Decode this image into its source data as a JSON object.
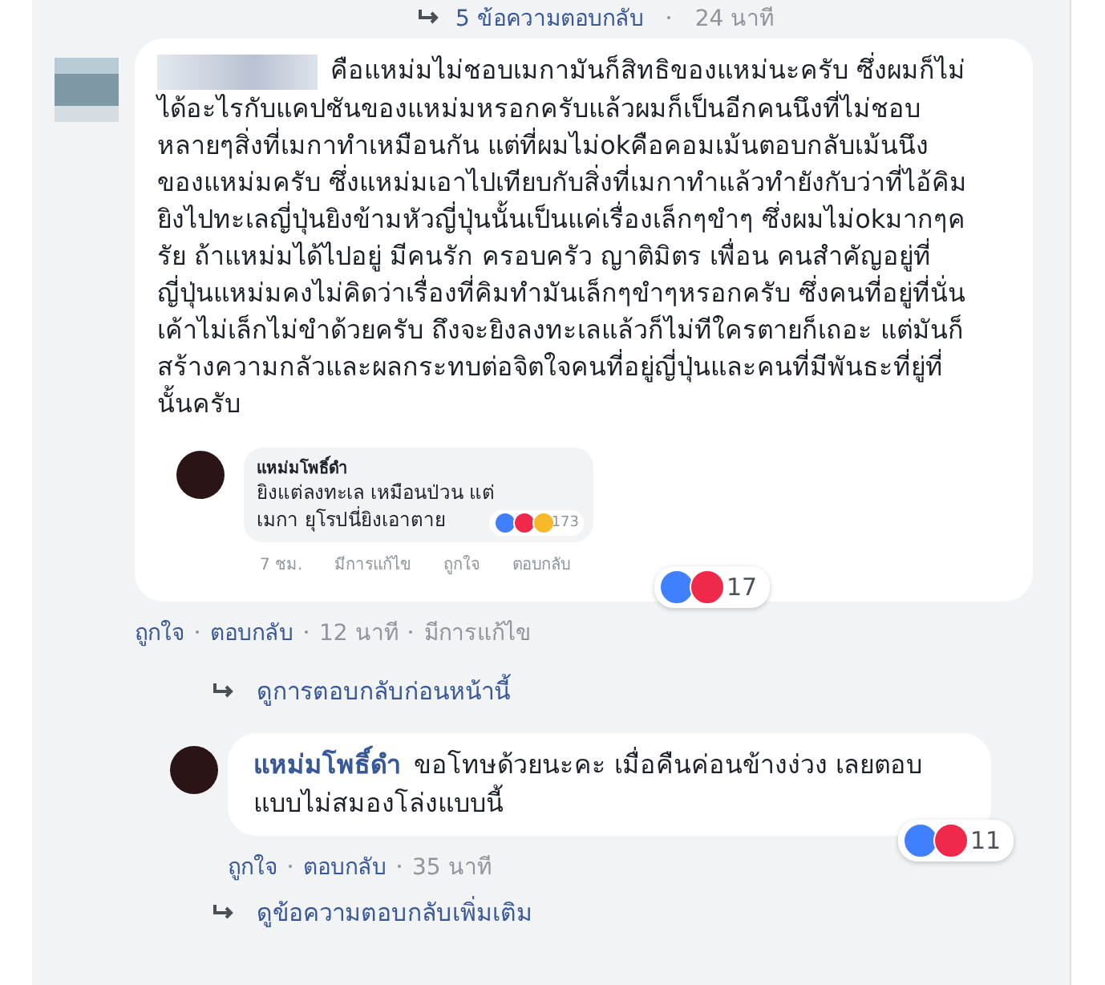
{
  "thread_header": {
    "replies_link": "5 ข้อความตอบกลับ",
    "time": "24 นาที"
  },
  "comment": {
    "text": "คือแหม่มไม่ชอบเมกามันก็สิทธิของแหม่นะครับ ซึ่งผมก็ไม่ได้อะไรกับแคปชันของแหม่มหรอกครับแล้วผมก็เป็นอีกคนนึงที่ไม่ชอบหลายๆสิ่งที่เมกาทำเหมือนกัน แต่ที่ผมไม่okคือคอมเม้นตอบกลับเม้นนึงของแหม่มครับ ซึ่งแหม่มเอาไปเทียบกับสิ่งที่เมกาทำแล้วทำยังกับว่าที่ไอ้คิมยิงไปทะเลญี่ปุ่นยิงข้ามหัวญี่ปุ่นนั้นเป็นแค่เรื่องเล็กๆขำๆ ซึ่งผมไม่okมากๆครัย ถ้าแหม่มได้ไปอยู่ มีคนรัก ครอบครัว ญาติมิตร เพื่อน คนสำคัญอยู่ที่ญี่ปุ่นแหม่มคงไม่คิดว่าเรื่องที่คิมทำมันเล็กๆขำๆหรอกครับ ซึ่งคนที่อยู่ที่นั่นเค้าไม่เล็กไม่ขำด้วยครับ ถึงจะยิงลงทะเลแล้วก็ไม่ทีใครตายก็เถอะ แต่มันก็สร้างความกลัวและผลกระทบต่อจิตใจคนที่อยู่ญี่ปุ่นและคนที่มีพันธะที่ยู่ที่นั้นครับ",
    "attachment": {
      "author": "แหม่มโพธิ์ดำ",
      "text": "ยิงแต่ลงทะเล เหมือนป่วน แต่เมกา ยุโรปนี่ยิงเอาตาย",
      "reaction_count": "173",
      "actions": [
        "7 ชม.",
        "มีการแก้ไข",
        "ถูกใจ",
        "ตอบกลับ"
      ]
    },
    "reaction_count": "17",
    "actions": [
      {
        "label": "ถูกใจ",
        "kind": "link"
      },
      {
        "label": "ตอบกลับ",
        "kind": "link"
      },
      {
        "label": "12 นาที",
        "kind": "meta"
      },
      {
        "label": "มีการแก้ไข",
        "kind": "meta"
      }
    ]
  },
  "previous_replies_link": "ดูการตอบกลับก่อนหน้านี้",
  "reply": {
    "author": "แหม่มโพธิ์ดำ",
    "text": "ขอโทษด้วยนะคะ เมื่อคืนค่อนข้างง่วง เลยตอบแบบไม่สมองโล่งแบบนี้",
    "reaction_count": "11",
    "actions": [
      {
        "label": "ถูกใจ",
        "kind": "link"
      },
      {
        "label": "ตอบกลับ",
        "kind": "link"
      },
      {
        "label": "35 นาที",
        "kind": "meta"
      }
    ]
  },
  "more_replies_link": "ดูข้อความตอบกลับเพิ่มเติม"
}
